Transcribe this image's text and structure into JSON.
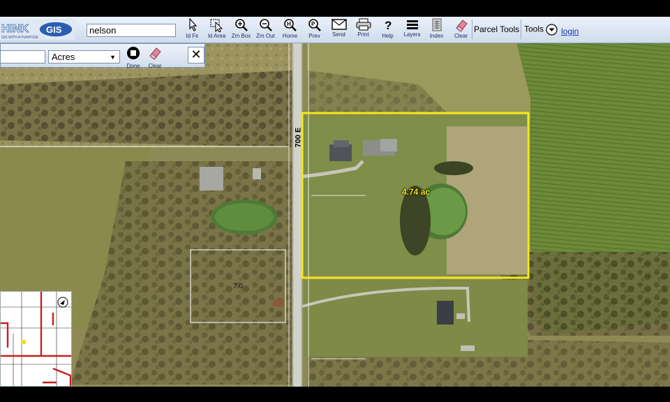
{
  "app": {
    "logo_text": "THINKGIS",
    "logo_tagline": "GIS WITH A PURPOSE"
  },
  "toolbar": {
    "search_value": "nelson",
    "buttons": [
      {
        "id": "id-fir",
        "label": "Id Fir",
        "icon": "pointer-icon"
      },
      {
        "id": "id-area",
        "label": "Id Area",
        "icon": "area-pointer-icon"
      },
      {
        "id": "zoom-box",
        "label": "Zm Box",
        "icon": "zoom-in-icon"
      },
      {
        "id": "zoom-out",
        "label": "Zm Out",
        "icon": "zoom-out-icon"
      },
      {
        "id": "home",
        "label": "Home",
        "icon": "home-icon"
      },
      {
        "id": "prev",
        "label": "Prev",
        "icon": "previous-view-icon"
      },
      {
        "id": "send",
        "label": "Send",
        "icon": "envelope-icon"
      },
      {
        "id": "print",
        "label": "Print",
        "icon": "printer-icon"
      },
      {
        "id": "help",
        "label": "Help",
        "icon": "question-icon"
      },
      {
        "id": "layers",
        "label": "Layers",
        "icon": "layers-icon"
      },
      {
        "id": "index",
        "label": "Index",
        "icon": "index-icon"
      },
      {
        "id": "clear",
        "label": "Clear",
        "icon": "eraser-icon"
      }
    ],
    "parcel_tools": "Parcel Tools",
    "tools": "Tools",
    "login": "login"
  },
  "measure": {
    "value": "",
    "unit": "Acres",
    "done_label": "Done",
    "clear_label": "Clear",
    "close_symbol": "✕"
  },
  "map": {
    "road_label": "700 E",
    "parcel_acres": "4.74 ac",
    "parcel2_label": "7.0",
    "parcel_outline_color": "#f5ea1a"
  }
}
